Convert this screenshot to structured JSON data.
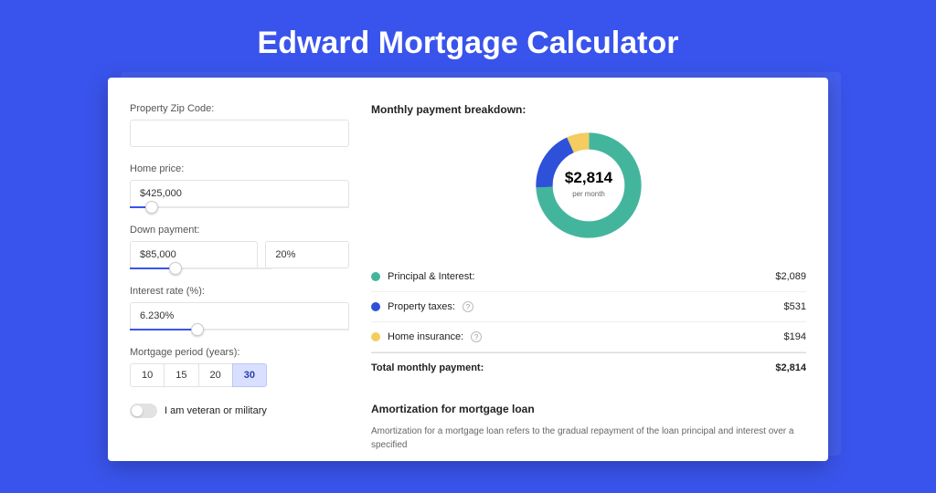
{
  "title": "Edward Mortgage Calculator",
  "form": {
    "zip_label": "Property Zip Code:",
    "zip_value": "",
    "price_label": "Home price:",
    "price_value": "$425,000",
    "down_label": "Down payment:",
    "down_value": "$85,000",
    "down_pct": "20%",
    "rate_label": "Interest rate (%):",
    "rate_value": "6.230%",
    "period_label": "Mortgage period (years):",
    "periods": [
      "10",
      "15",
      "20",
      "30"
    ],
    "period_active": "30",
    "vet_label": "I am veteran or military"
  },
  "breakdown": {
    "title": "Monthly payment breakdown:",
    "center_amount": "$2,814",
    "center_sub": "per month",
    "items": [
      {
        "label": "Principal & Interest:",
        "value": "$2,089",
        "color": "#44b59d",
        "help": false
      },
      {
        "label": "Property taxes:",
        "value": "$531",
        "color": "#2e51da",
        "help": true
      },
      {
        "label": "Home insurance:",
        "value": "$194",
        "color": "#f4cc5f",
        "help": true
      }
    ],
    "total_label": "Total monthly payment:",
    "total_value": "$2,814"
  },
  "amort": {
    "title": "Amortization for mortgage loan",
    "text": "Amortization for a mortgage loan refers to the gradual repayment of the loan principal and interest over a specified"
  },
  "chart_data": {
    "type": "pie",
    "title": "Monthly payment breakdown",
    "categories": [
      "Principal & Interest",
      "Property taxes",
      "Home insurance"
    ],
    "values": [
      2089,
      531,
      194
    ],
    "colors": [
      "#44b59d",
      "#2e51da",
      "#f4cc5f"
    ],
    "total": 2814,
    "center_label": "$2,814 per month"
  }
}
